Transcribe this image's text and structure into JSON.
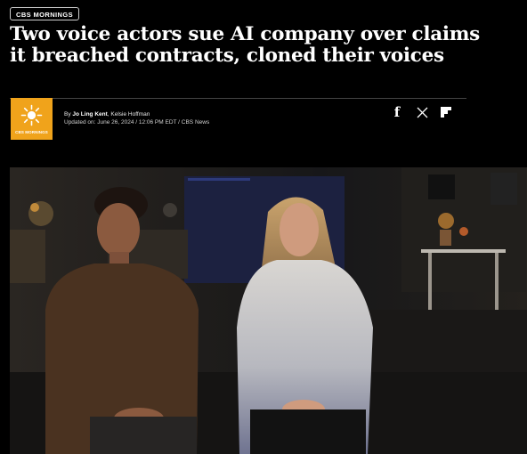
{
  "section_badge": "CBS MORNINGS",
  "headline": "Two voice actors sue AI company over claims it breached contracts, cloned their voices",
  "logo": {
    "text": "CBS MORNINGS",
    "icon": "sun-icon",
    "color": "#f0a31b"
  },
  "byline": {
    "prefix": "By",
    "authors": [
      "Jo Ling Kent",
      "Kelsie Hoffman"
    ],
    "updated_label": "Updated on:",
    "updated_value": "June 26, 2024 / 12:06 PM EDT / CBS News"
  },
  "share": {
    "facebook_icon": "facebook-icon",
    "x_icon": "x-icon",
    "flipboard_icon": "flipboard-icon"
  },
  "hero_image": {
    "alt": "Two voice actors seated side by side in a dim living room"
  }
}
